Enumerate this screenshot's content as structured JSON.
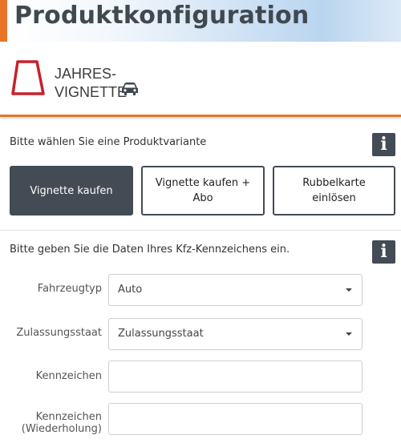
{
  "header": {
    "title": "Produktkonfiguration"
  },
  "product": {
    "name_line1": "JAHRES-",
    "name_line2": "VIGNETTE",
    "icon": "vignette-icon",
    "vehicle_icon": "car-icon"
  },
  "variant_section": {
    "label": "Bitte wählen Sie eine Produktvariante",
    "info": "i",
    "options": [
      {
        "label": "Vignette kaufen",
        "selected": true
      },
      {
        "label": "Vignette kaufen + Abo",
        "selected": false
      },
      {
        "label": "Rubbelkarte einlösen",
        "selected": false
      }
    ]
  },
  "plate_section": {
    "label": "Bitte geben Sie die Daten Ihres Kfz-Kennzeichens ein.",
    "info": "i",
    "fields": {
      "vehicle_type": {
        "label": "Fahrzeugtyp",
        "value": "Auto"
      },
      "country": {
        "label": "Zulassungsstaat",
        "value": "Zulassungsstaat"
      },
      "plate": {
        "label": "Kennzeichen",
        "value": ""
      },
      "plate_repeat": {
        "label_line1": "Kennzeichen",
        "label_line2": "(Wiederholung)",
        "value": ""
      }
    }
  },
  "colors": {
    "accent": "#e8742a",
    "dark": "#434b54"
  }
}
